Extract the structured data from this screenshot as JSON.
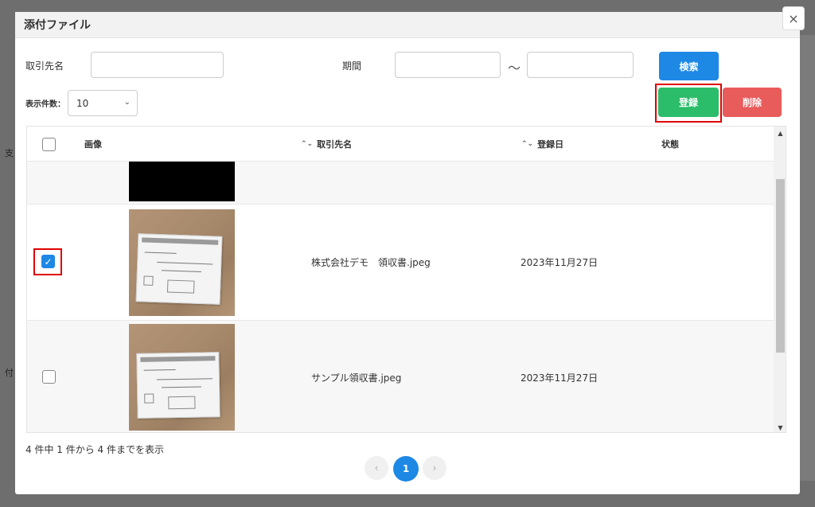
{
  "modal": {
    "title": "添付ファイル",
    "close_label": "×"
  },
  "background": {
    "text_1": "支",
    "text_2": "付"
  },
  "filters": {
    "client_label": "取引先名",
    "client_value": "",
    "period_label": "期間",
    "period_from": "",
    "period_to": "",
    "tilde": "～",
    "search_label": "検索"
  },
  "display": {
    "count_label": "表示件数：",
    "count_value": "10"
  },
  "actions": {
    "register_label": "登録",
    "delete_label": "削除"
  },
  "table": {
    "columns": {
      "image": "画像",
      "client": "取引先名",
      "date": "登録日",
      "status": "状態"
    },
    "rows": [
      {
        "client": "",
        "date": "",
        "status": "",
        "checked": false
      },
      {
        "client": "株式会社デモ　領収書.jpeg",
        "date": "2023年11月27日",
        "status": "",
        "checked": true
      },
      {
        "client": "サンプル領収書.jpeg",
        "date": "2023年11月27日",
        "status": "",
        "checked": false
      }
    ]
  },
  "footer": {
    "summary": "4 件中 1 件から 4 件までを表示"
  },
  "pagination": {
    "prev": "‹",
    "current": "1",
    "next": "›"
  },
  "colors": {
    "primary": "#1e88e5",
    "success": "#2cbd6a",
    "danger": "#e85c5c",
    "highlight": "#e00000"
  }
}
